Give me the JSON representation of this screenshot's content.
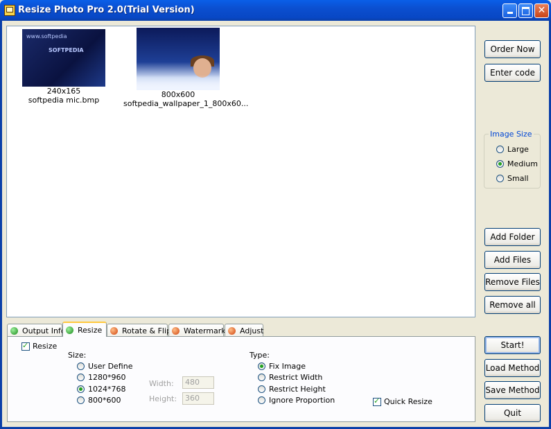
{
  "window": {
    "title": "Resize Photo Pro 2.0(Trial Version)"
  },
  "thumbnails": [
    {
      "dimensions": "240x165",
      "filename": "softpedia mic.bmp",
      "logo": "SOFTPEDIA",
      "url": "www.softpedia"
    },
    {
      "dimensions": "800x600",
      "filename": "softpedia_wallpaper_1_800x60..."
    }
  ],
  "sidebar": {
    "order_now": "Order Now",
    "enter_code": "Enter code",
    "image_size": {
      "legend": "Image Size",
      "options": [
        "Large",
        "Medium",
        "Small"
      ],
      "selected": "Medium"
    },
    "add_folder": "Add Folder",
    "add_files": "Add Files",
    "remove_files": "Remove Files",
    "remove_all": "Remove all",
    "start": "Start!",
    "load_method": "Load Method",
    "save_method": "Save Method",
    "quit": "Quit"
  },
  "tabs": [
    {
      "label": "Output Info",
      "icon": "green-ball-icon"
    },
    {
      "label": "Resize",
      "icon": "green-ball-icon",
      "active": true
    },
    {
      "label": "Rotate & Flip",
      "icon": "orange-ball-icon"
    },
    {
      "label": "Watermark",
      "icon": "orange-ball-icon"
    },
    {
      "label": "Adjust",
      "icon": "orange-ball-icon"
    }
  ],
  "resize": {
    "enable_label": "Resize",
    "enabled": true,
    "size_label": "Size:",
    "size_options": [
      "User Define",
      "1280*960",
      "1024*768",
      "800*600"
    ],
    "size_selected": "1024*768",
    "width_label": "Width:",
    "width_value": "480",
    "height_label": "Height:",
    "height_value": "360",
    "type_label": "Type:",
    "type_options": [
      "Fix Image",
      "Restrict Width",
      "Restrict Height",
      "Ignore Proportion"
    ],
    "type_selected": "Fix Image",
    "quick_resize_label": "Quick Resize",
    "quick_resize": true
  },
  "colors": {
    "titlebar": "#0a5fe8",
    "face": "#ece9d8",
    "tab_highlight": "#ffc83c",
    "radio_dot": "#21a121"
  }
}
